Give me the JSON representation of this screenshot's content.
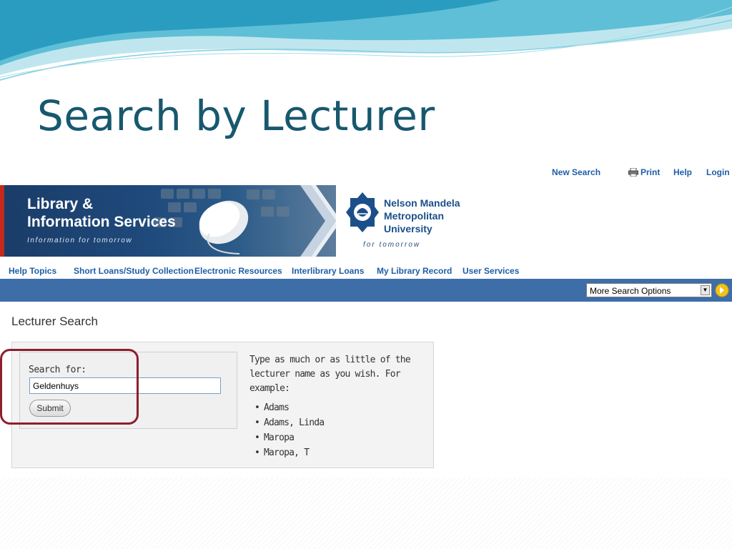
{
  "slide": {
    "title": "Search by Lecturer"
  },
  "utility_links": {
    "new_search": "New Search",
    "print": "Print",
    "help": "Help",
    "login": "Login"
  },
  "banner": {
    "library_line1": "Library &",
    "library_line2": "Information Services",
    "library_tagline": "Information for tomorrow",
    "university_line1": "Nelson Mandela",
    "university_line2": "Metropolitan",
    "university_line3": "University",
    "university_tagline": "for tomorrow"
  },
  "nav": [
    {
      "label": "Help Topics"
    },
    {
      "label": "Short Loans/Study Collection"
    },
    {
      "label": "Electronic Resources"
    },
    {
      "label": "Interlibrary Loans"
    },
    {
      "label": "My Library Record"
    },
    {
      "label": "User Services"
    }
  ],
  "search_options": {
    "selected": "More Search Options"
  },
  "lecturer_search": {
    "heading": "Lecturer Search",
    "search_label": "Search for:",
    "search_value": "Geldenhuys",
    "submit_label": "Submit",
    "help_text": "Type as much or as little of the lecturer name as you wish. For example:",
    "examples": [
      "Adams",
      "Adams, Linda",
      "Maropa",
      "Maropa, T"
    ]
  },
  "colors": {
    "title": "#17586e",
    "link": "#1f5ea8",
    "nav_bar": "#3d6ea8",
    "highlight": "#8e1f2e"
  }
}
